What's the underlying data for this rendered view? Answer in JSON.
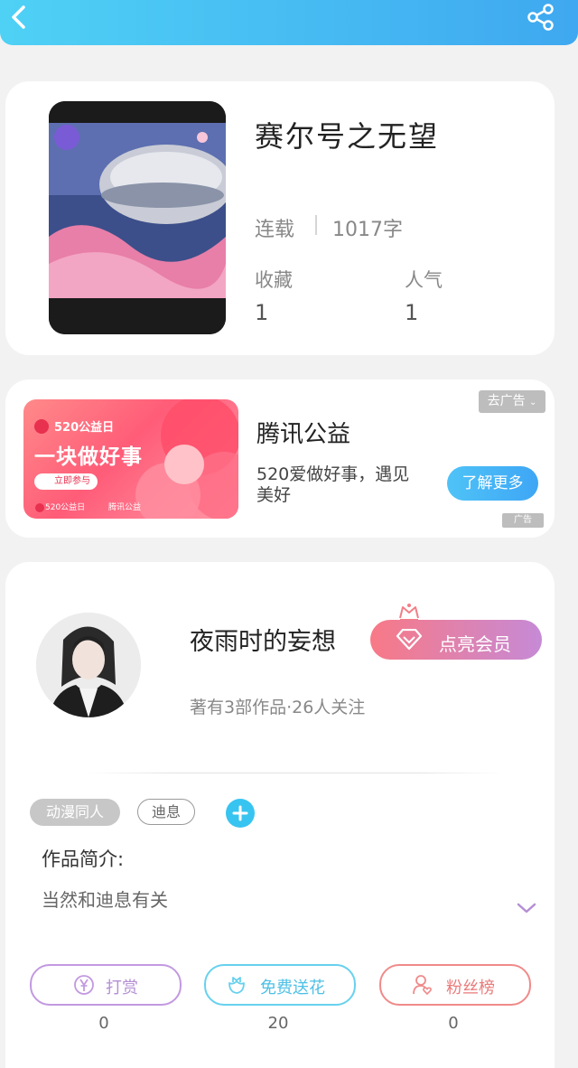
{
  "book": {
    "title": "赛尔号之无望",
    "status": "连载",
    "word_count": "1017字",
    "stats": [
      {
        "label": "收藏",
        "value": "1"
      },
      {
        "label": "人气",
        "value": "1"
      }
    ]
  },
  "ad": {
    "title": "腾讯公益",
    "description": "520爱做好事，遇见美好",
    "close_label": "去广告",
    "cta_label": "了解更多",
    "ad_tag": "广告",
    "banner": {
      "event": "520公益日",
      "headline": "一块做好事",
      "join_label": "立即参与",
      "footer_left": "520公益日",
      "footer_right": "腾讯公益"
    }
  },
  "author": {
    "name": "夜雨时的妄想",
    "vip_label": "点亮会员",
    "meta": "著有3部作品·26人关注"
  },
  "tags": [
    "动漫同人",
    "迪息"
  ],
  "intro": {
    "label": "作品简介:",
    "text": "当然和迪息有关"
  },
  "actions": [
    {
      "label": "打赏",
      "count": "0"
    },
    {
      "label": "免费送花",
      "count": "20"
    },
    {
      "label": "粉丝榜",
      "count": "0"
    }
  ],
  "colors": {
    "header_start": "#4fd1f5",
    "header_end": "#3fa8f0",
    "vip_start": "#f87986",
    "vip_end": "#c68ad6",
    "reward": "#c299e0",
    "flower": "#67d1ee",
    "fans": "#f08a8a"
  },
  "icons": [
    "back-arrow-icon",
    "share-icon",
    "crown-icon",
    "diamond-icon",
    "plus-icon",
    "chevron-down-icon",
    "yen-icon",
    "flower-icon",
    "user-heart-icon"
  ]
}
